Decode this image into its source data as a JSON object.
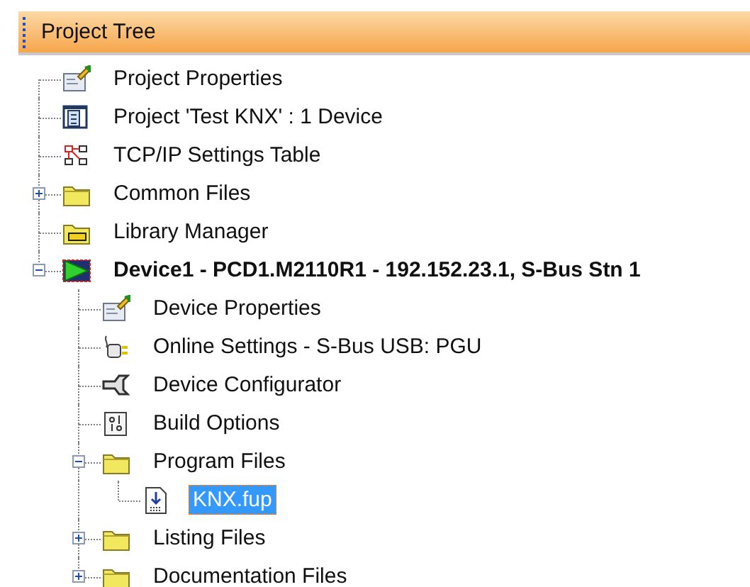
{
  "panel": {
    "title": "Project Tree"
  },
  "tree": [
    {
      "label": "Project Properties",
      "kind": "properties",
      "selected": false
    },
    {
      "label": "Project 'Test KNX' : 1 Device",
      "kind": "project",
      "selected": false
    },
    {
      "label": "TCP/IP Settings Table",
      "kind": "network",
      "selected": false
    },
    {
      "label": "Common Files",
      "kind": "folder",
      "expanded": false,
      "selected": false
    },
    {
      "label": "Library Manager",
      "kind": "library",
      "selected": false
    },
    {
      "label": "Device1 - PCD1.M2110R1 - 192.152.23.1, S-Bus Stn 1",
      "kind": "device",
      "expanded": true,
      "selected": false,
      "children": [
        {
          "label": "Device Properties",
          "kind": "properties",
          "selected": false
        },
        {
          "label": "Online Settings - S-Bus USB: PGU",
          "kind": "plug",
          "selected": false
        },
        {
          "label": "Device Configurator",
          "kind": "wrench",
          "selected": false
        },
        {
          "label": "Build Options",
          "kind": "options",
          "selected": false
        },
        {
          "label": "Program Files",
          "kind": "folder",
          "expanded": true,
          "selected": false,
          "children": [
            {
              "label": "KNX.fup",
              "kind": "file",
              "selected": true
            }
          ]
        },
        {
          "label": "Listing Files",
          "kind": "folder",
          "expanded": false,
          "selected": false
        },
        {
          "label": "Documentation Files",
          "kind": "folder",
          "expanded": false,
          "selected": false
        }
      ]
    }
  ]
}
